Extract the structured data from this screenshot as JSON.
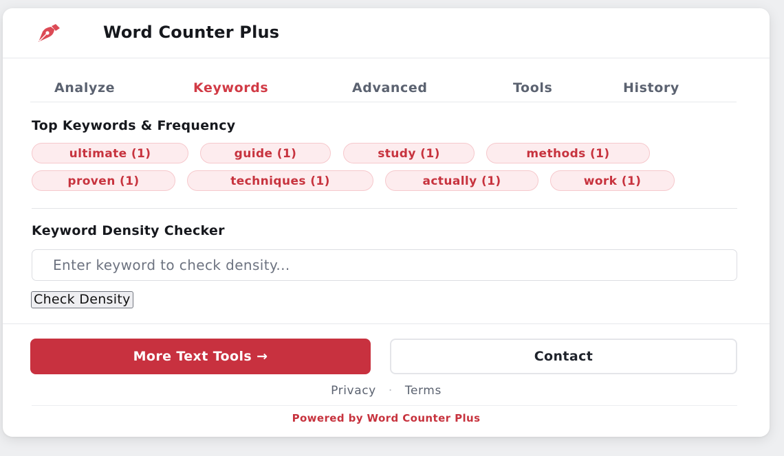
{
  "app": {
    "title": "Word Counter Plus",
    "logo_icon": "pen-nib-icon",
    "accent_color": "#c8313f"
  },
  "tabs": [
    {
      "label": "Analyze",
      "active": false
    },
    {
      "label": "Keywords",
      "active": true
    },
    {
      "label": "Advanced",
      "active": false
    },
    {
      "label": "Tools",
      "active": false
    },
    {
      "label": "History",
      "active": false
    }
  ],
  "keywords": {
    "title": "Top Keywords & Frequency",
    "chips": [
      "ultimate (1)",
      "guide (1)",
      "study (1)",
      "methods (1)",
      "proven (1)",
      "techniques (1)",
      "actually (1)",
      "work (1)"
    ]
  },
  "density": {
    "title": "Keyword Density Checker",
    "input_value": "",
    "input_placeholder": "Enter keyword to check density...",
    "button_label": "Check Density"
  },
  "footer": {
    "primary_button": "More Text Tools →",
    "secondary_button": "Contact",
    "links": [
      "Privacy",
      "Terms"
    ],
    "separator": "·",
    "powered_by": "Powered by Word Counter Plus"
  }
}
